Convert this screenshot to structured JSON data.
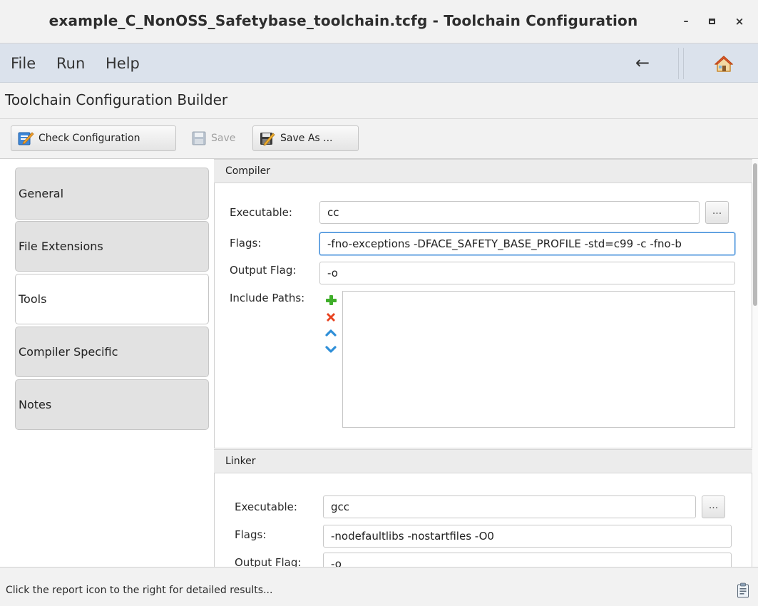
{
  "window": {
    "title": "example_C_NonOSS_Safetybase_toolchain.tcfg - Toolchain Configuration",
    "minimize_glyph": "–",
    "close_glyph": "×"
  },
  "menu": {
    "items": [
      "File",
      "Run",
      "Help"
    ],
    "back_glyph": "←",
    "back_icon": "left-arrow-icon",
    "home_icon": "home-icon"
  },
  "heading": "Toolchain Configuration Builder",
  "toolbar": {
    "check_label": "Check Configuration",
    "save_label": "Save",
    "save_as_label": "Save As ..."
  },
  "tabs": [
    "General",
    "File Extensions",
    "Tools",
    "Compiler Specific",
    "Notes"
  ],
  "active_tab": "Tools",
  "compiler": {
    "header": "Compiler",
    "executable_label": "Executable:",
    "executable_value": "cc",
    "browse_label": "...",
    "flags_label": "Flags:",
    "flags_value": "-fno-exceptions -DFACE_SAFETY_BASE_PROFILE -std=c99 -c -fno-b",
    "output_flag_label": "Output Flag:",
    "output_flag_value": "-o",
    "include_paths_label": "Include Paths:",
    "include_actions": [
      "add-icon",
      "remove-icon",
      "move-up-icon",
      "move-down-icon"
    ]
  },
  "linker": {
    "header": "Linker",
    "executable_label": "Executable:",
    "executable_value": "gcc",
    "browse_label": "...",
    "flags_label": "Flags:",
    "flags_value": "-nodefaultlibs -nostartfiles -O0",
    "output_flag_label": "Output Flag:",
    "output_flag_value": "-o"
  },
  "status": {
    "message": "Click the report icon to the right for detailed results..."
  },
  "colors": {
    "menubar_bg": "#dbe2ec",
    "focus_border": "#3a8ad9",
    "add_green": "#3fae2a",
    "remove_red": "#e8421f",
    "arrow_blue": "#2f8fd8"
  }
}
